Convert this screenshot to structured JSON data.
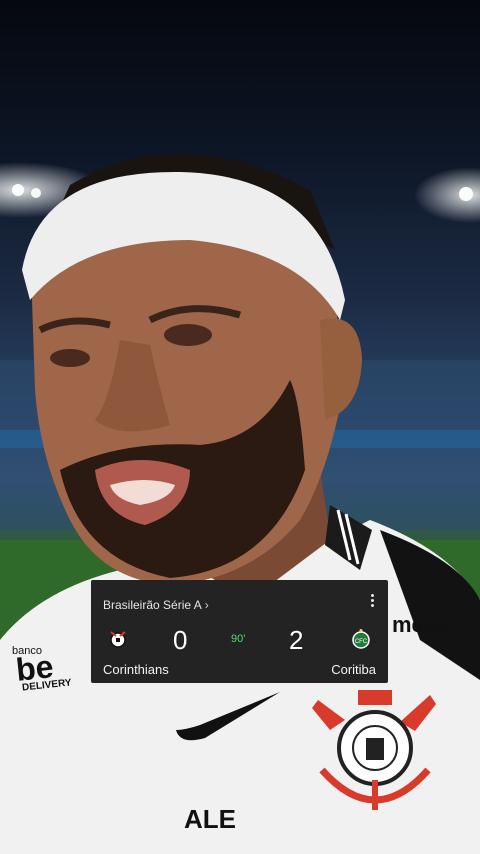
{
  "scoreboard": {
    "competition": "Brasileirão Série A",
    "competition_arrow": "›",
    "home_team": "Corinthians",
    "home_score": "0",
    "away_team": "Coritiba",
    "away_score": "2",
    "match_clock": "90'",
    "clock_color": "#5bd96b",
    "menu_icon": "more-vert-icon"
  },
  "jersey": {
    "sponsor_left_line1": "banco",
    "sponsor_left_line2": "be",
    "sponsor_left_line3": "DELIVERY",
    "sponsor_right": "mesa",
    "sponsor_bottom": "ALE",
    "brand_icon": "swoosh-icon",
    "club_crest_icon": "corinthians-crest-icon"
  }
}
